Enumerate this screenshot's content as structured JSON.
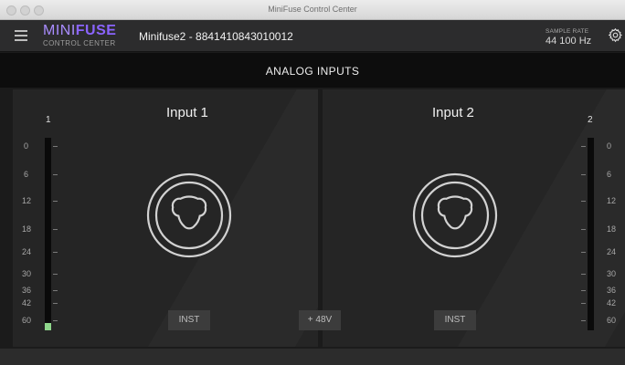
{
  "window": {
    "title": "MiniFuse Control Center"
  },
  "header": {
    "logo_main_light": "MINI",
    "logo_main_bold": "FUSE",
    "logo_sub": "CONTROL CENTER",
    "device_name": "Minifuse2 - 8841410843010012",
    "sample_rate_label": "SAMPLE RATE",
    "sample_rate_value": "44 100 Hz"
  },
  "section": {
    "title": "ANALOG INPUTS"
  },
  "inputs": [
    {
      "title": "Input 1",
      "channel": "1",
      "inst_label": "INST",
      "level_fraction": 0.04
    },
    {
      "title": "Input 2",
      "channel": "2",
      "inst_label": "INST",
      "level_fraction": 0.0
    }
  ],
  "phantom": {
    "label": "+ 48V"
  },
  "meter_scale": [
    "0",
    "6",
    "12",
    "18",
    "24",
    "30",
    "36",
    "42",
    "60"
  ],
  "colors": {
    "accent": "#8b64ff",
    "meter_fill": "#8ed68b",
    "panel_bg": "#252525",
    "header_bg": "#2c2c2d",
    "section_bg": "#0d0d0d"
  },
  "icons": {
    "menu": "hamburger-menu-icon",
    "settings": "gear-icon",
    "connector": "xlr-combo-jack-icon"
  }
}
